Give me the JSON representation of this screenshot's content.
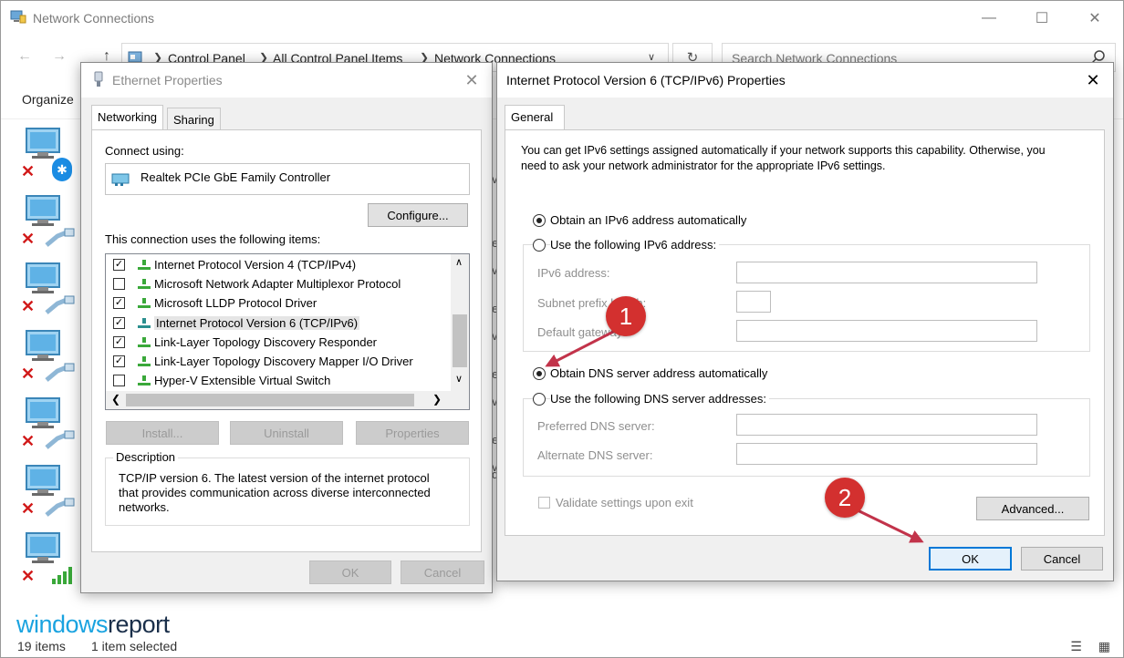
{
  "explorer": {
    "title": "Network Connections",
    "breadcrumb": [
      "Control Panel",
      "All Control Panel Items",
      "Network Connections"
    ],
    "search_placeholder": "Search Network Connections",
    "organize_label": "Organize",
    "status_items": "19 items",
    "status_selected": "1 item selected",
    "bg_snippets": [
      "v",
      "e",
      "v",
      "e",
      "v",
      "e",
      "v",
      "e",
      "v",
      "d"
    ]
  },
  "logo": {
    "part1": "windows",
    "part2": "report"
  },
  "ethernet": {
    "title": "Ethernet Properties",
    "tabs": [
      "Networking",
      "Sharing"
    ],
    "connect_using_label": "Connect using:",
    "adapter_name": "Realtek PCIe GbE Family Controller",
    "configure_label": "Configure...",
    "items_label": "This connection uses the following items:",
    "items": [
      {
        "label": "Internet Protocol Version 4 (TCP/IPv4)",
        "checked": true
      },
      {
        "label": "Microsoft Network Adapter Multiplexor Protocol",
        "checked": false
      },
      {
        "label": "Microsoft LLDP Protocol Driver",
        "checked": true
      },
      {
        "label": "Internet Protocol Version 6 (TCP/IPv6)",
        "checked": true,
        "selected": true
      },
      {
        "label": "Link-Layer Topology Discovery Responder",
        "checked": true
      },
      {
        "label": "Link-Layer Topology Discovery Mapper I/O Driver",
        "checked": true
      },
      {
        "label": "Hyper-V Extensible Virtual Switch",
        "checked": false
      }
    ],
    "install_label": "Install...",
    "uninstall_label": "Uninstall",
    "properties_label": "Properties",
    "description_label": "Description",
    "description_text": "TCP/IP version 6. The latest version of the internet protocol that provides communication across diverse interconnected networks.",
    "ok_label": "OK",
    "cancel_label": "Cancel"
  },
  "ipv6": {
    "title": "Internet Protocol Version 6 (TCP/IPv6) Properties",
    "tab_general": "General",
    "intro_text": "You can get IPv6 settings assigned automatically if your network supports this capability. Otherwise, you need to ask your network administrator for the appropriate IPv6 settings.",
    "obtain_ip_auto": "Obtain an IPv6 address automatically",
    "use_following_ip": "Use the following IPv6 address:",
    "ipv6_address_label": "IPv6 address:",
    "subnet_prefix_label": "Subnet prefix length:",
    "default_gateway_label": "Default gateway:",
    "obtain_dns_auto": "Obtain DNS server address automatically",
    "use_following_dns": "Use the following DNS server addresses:",
    "preferred_dns_label": "Preferred DNS server:",
    "alternate_dns_label": "Alternate DNS server:",
    "validate_label": "Validate settings upon exit",
    "advanced_label": "Advanced...",
    "ok_label": "OK",
    "cancel_label": "Cancel",
    "ip_mode": "auto",
    "dns_mode": "auto"
  },
  "annotations": {
    "badge1": "1",
    "badge2": "2",
    "color": "#d3302f"
  }
}
